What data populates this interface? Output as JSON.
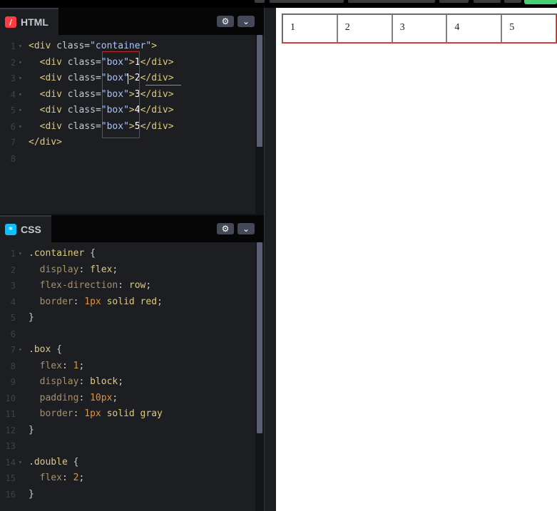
{
  "html_panel": {
    "title": "HTML",
    "badge": "/",
    "badge_color": "#ff3c41",
    "lines": [
      {
        "n": "1",
        "fold": true,
        "parts": [
          [
            "t",
            "<div "
          ],
          [
            "a",
            "class"
          ],
          [
            "p",
            "="
          ],
          [
            "s",
            "\"container\""
          ],
          [
            "t",
            ">"
          ]
        ]
      },
      {
        "n": "2",
        "fold": true,
        "parts": [
          [
            "t",
            "  <div "
          ],
          [
            "a",
            "class"
          ],
          [
            "p",
            "="
          ],
          [
            "s",
            "\"box\""
          ],
          [
            "t",
            ">"
          ],
          [
            "w",
            "1"
          ],
          [
            "t",
            "</div>"
          ]
        ]
      },
      {
        "n": "3",
        "fold": true,
        "parts": [
          [
            "t",
            "  <div "
          ],
          [
            "a",
            "class"
          ],
          [
            "p",
            "="
          ],
          [
            "s",
            "\"box\""
          ],
          [
            "t",
            ">"
          ],
          [
            "w",
            "2"
          ],
          [
            "t",
            "</div>"
          ]
        ]
      },
      {
        "n": "4",
        "fold": true,
        "parts": [
          [
            "t",
            "  <div "
          ],
          [
            "a",
            "class"
          ],
          [
            "p",
            "="
          ],
          [
            "s",
            "\"box\""
          ],
          [
            "t",
            ">"
          ],
          [
            "w",
            "3"
          ],
          [
            "t",
            "</div>"
          ]
        ]
      },
      {
        "n": "5",
        "fold": true,
        "parts": [
          [
            "t",
            "  <div "
          ],
          [
            "a",
            "class"
          ],
          [
            "p",
            "="
          ],
          [
            "s",
            "\"box\""
          ],
          [
            "t",
            ">"
          ],
          [
            "w",
            "4"
          ],
          [
            "t",
            "</div>"
          ]
        ]
      },
      {
        "n": "6",
        "fold": true,
        "parts": [
          [
            "t",
            "  <div "
          ],
          [
            "a",
            "class"
          ],
          [
            "p",
            "="
          ],
          [
            "s",
            "\"box\""
          ],
          [
            "t",
            ">"
          ],
          [
            "w",
            "5"
          ],
          [
            "t",
            "</div>"
          ]
        ]
      },
      {
        "n": "7",
        "fold": false,
        "parts": [
          [
            "t",
            "</div>"
          ]
        ]
      },
      {
        "n": "8",
        "fold": false,
        "parts": []
      }
    ]
  },
  "css_panel": {
    "title": "CSS",
    "badge": "*",
    "badge_color": "#0ebeff",
    "lines": [
      {
        "n": "1",
        "fold": true,
        "parts": [
          [
            "sel",
            ".container "
          ],
          [
            "pun",
            "{"
          ]
        ]
      },
      {
        "n": "2",
        "fold": false,
        "parts": [
          [
            "prop",
            "  display"
          ],
          [
            "pun",
            ": "
          ],
          [
            "val",
            "flex"
          ],
          [
            "pun",
            ";"
          ]
        ]
      },
      {
        "n": "3",
        "fold": false,
        "parts": [
          [
            "prop",
            "  flex-direction"
          ],
          [
            "pun",
            ": "
          ],
          [
            "val",
            "row"
          ],
          [
            "pun",
            ";"
          ]
        ]
      },
      {
        "n": "4",
        "fold": false,
        "parts": [
          [
            "prop",
            "  border"
          ],
          [
            "pun",
            ": "
          ],
          [
            "num",
            "1px"
          ],
          [
            "val",
            " solid red"
          ],
          [
            "pun",
            ";"
          ]
        ]
      },
      {
        "n": "5",
        "fold": false,
        "parts": [
          [
            "pun",
            "}"
          ]
        ]
      },
      {
        "n": "6",
        "fold": false,
        "parts": []
      },
      {
        "n": "7",
        "fold": true,
        "parts": [
          [
            "sel",
            ".box "
          ],
          [
            "pun",
            "{"
          ]
        ]
      },
      {
        "n": "8",
        "fold": false,
        "parts": [
          [
            "prop",
            "  flex"
          ],
          [
            "pun",
            ": "
          ],
          [
            "num",
            "1"
          ],
          [
            "pun",
            ";"
          ]
        ]
      },
      {
        "n": "9",
        "fold": false,
        "parts": [
          [
            "prop",
            "  display"
          ],
          [
            "pun",
            ": "
          ],
          [
            "val",
            "block"
          ],
          [
            "pun",
            ";"
          ]
        ]
      },
      {
        "n": "10",
        "fold": false,
        "parts": [
          [
            "prop",
            "  padding"
          ],
          [
            "pun",
            ": "
          ],
          [
            "num",
            "10px"
          ],
          [
            "pun",
            ";"
          ]
        ]
      },
      {
        "n": "11",
        "fold": false,
        "parts": [
          [
            "prop",
            "  border"
          ],
          [
            "pun",
            ": "
          ],
          [
            "num",
            "1px"
          ],
          [
            "val",
            " solid gray"
          ]
        ]
      },
      {
        "n": "12",
        "fold": false,
        "parts": [
          [
            "pun",
            "}"
          ]
        ]
      },
      {
        "n": "13",
        "fold": false,
        "parts": []
      },
      {
        "n": "14",
        "fold": true,
        "parts": [
          [
            "sel",
            ".double "
          ],
          [
            "pun",
            "{"
          ]
        ]
      },
      {
        "n": "15",
        "fold": false,
        "parts": [
          [
            "prop",
            "  flex"
          ],
          [
            "pun",
            ": "
          ],
          [
            "num",
            "2"
          ],
          [
            "pun",
            ";"
          ]
        ]
      },
      {
        "n": "16",
        "fold": false,
        "parts": [
          [
            "pun",
            "}"
          ]
        ]
      }
    ]
  },
  "settings_icon": "gear-icon",
  "collapse_icon": "chevron-down-icon",
  "preview": {
    "boxes": [
      "1",
      "2",
      "3",
      "4",
      "5"
    ]
  },
  "colors": {
    "accent_green": "#47cf73",
    "highlight_red": "#c0262a"
  }
}
